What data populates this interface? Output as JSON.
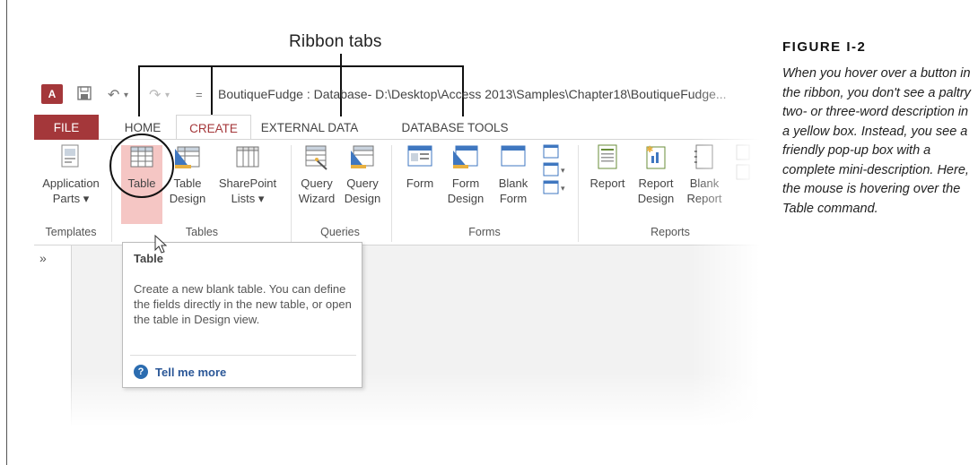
{
  "callout": {
    "label": "Ribbon tabs"
  },
  "figure": {
    "title": "FIGURE I-2",
    "caption": "When you hover over a button in the ribbon, you don't see a paltry two- or three-word description in a yellow box. Instead, you see a friendly pop-up box with a complete mini-description. Here, the mouse is hovering over the Table command."
  },
  "window": {
    "title": "BoutiqueFudge : Database- D:\\Desktop\\Access 2013\\Samples\\Chapter18\\BoutiqueFudge...",
    "logo_text": "A",
    "qat_dropdown": "="
  },
  "tabs": [
    {
      "label": "FILE"
    },
    {
      "label": "HOME"
    },
    {
      "label": "CREATE",
      "active": true
    },
    {
      "label": "EXTERNAL DATA"
    },
    {
      "label": "DATABASE TOOLS"
    }
  ],
  "groups": {
    "templates": {
      "label": "Templates",
      "buttons": [
        {
          "line1": "Application",
          "line2": "Parts ▾"
        }
      ]
    },
    "tables": {
      "label": "Tables",
      "buttons": [
        {
          "line1": "Table",
          "line2": ""
        },
        {
          "line1": "Table",
          "line2": "Design"
        },
        {
          "line1": "SharePoint",
          "line2": "Lists ▾"
        }
      ]
    },
    "queries": {
      "label": "Queries",
      "buttons": [
        {
          "line1": "Query",
          "line2": "Wizard"
        },
        {
          "line1": "Query",
          "line2": "Design"
        }
      ]
    },
    "forms": {
      "label": "Forms",
      "buttons": [
        {
          "line1": "Form",
          "line2": ""
        },
        {
          "line1": "Form",
          "line2": "Design"
        },
        {
          "line1": "Blank",
          "line2": "Form"
        }
      ]
    },
    "reports": {
      "label": "Reports",
      "buttons": [
        {
          "line1": "Report",
          "line2": ""
        },
        {
          "line1": "Report",
          "line2": "Design"
        },
        {
          "line1": "Blank",
          "line2": "Report"
        }
      ]
    }
  },
  "nav_pane": {
    "shutter": "»"
  },
  "tooltip": {
    "title": "Table",
    "body": "Create a new blank table. You can define the fields directly in the new table, or open the table in Design view.",
    "help_icon": "?",
    "help_label": "Tell me more"
  },
  "colors": {
    "accent": "#a4373a",
    "link": "#2b5797",
    "highlight": "#f5c6c4"
  }
}
